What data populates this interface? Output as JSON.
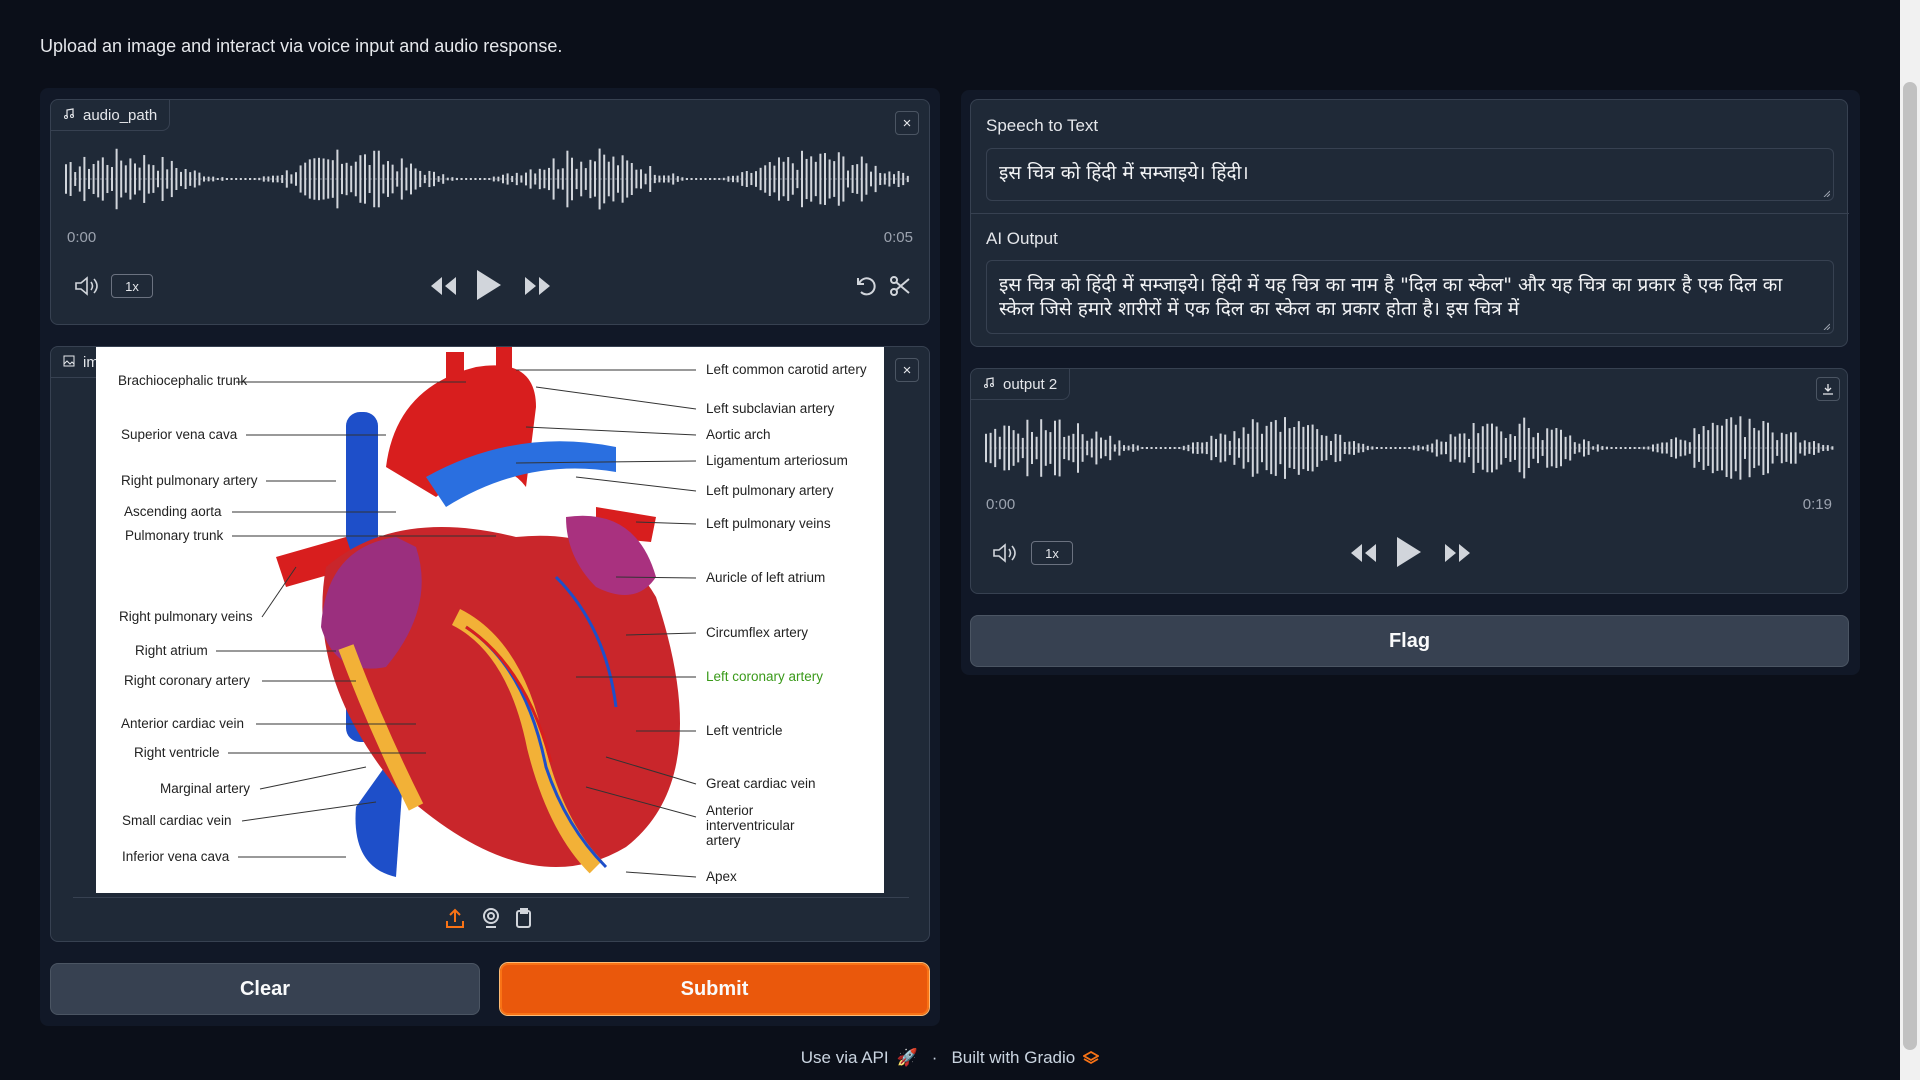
{
  "description": "Upload an image and interact via voice input and audio response.",
  "audio_input": {
    "label": "audio_path",
    "time_start": "0:00",
    "time_end": "0:05",
    "playback_rate": "1x"
  },
  "image_input": {
    "label": "image_path",
    "diagram_labels": {
      "left": [
        "Brachiocephalic trunk",
        "Superior vena cava",
        "Right pulmonary artery",
        "Ascending aorta",
        "Pulmonary trunk",
        "Right pulmonary veins",
        "Right atrium",
        "Right coronary artery",
        "Anterior cardiac vein",
        "Right ventricle",
        "Marginal artery",
        "Small cardiac vein",
        "Inferior vena cava"
      ],
      "right": [
        "Left common carotid artery",
        "Left subclavian artery",
        "Aortic arch",
        "Ligamentum arteriosum",
        "Left pulmonary artery",
        "Left pulmonary veins",
        "Auricle of left atrium",
        "Circumflex artery",
        "Left coronary artery",
        "Left ventricle",
        "Great cardiac vein",
        "Anterior interventricular artery",
        "Apex"
      ]
    }
  },
  "buttons": {
    "clear": "Clear",
    "submit": "Submit",
    "flag": "Flag"
  },
  "speech_to_text": {
    "label": "Speech to Text",
    "value": "इस चित्र को हिंदी में सम्जाइये। हिंदी।"
  },
  "ai_output": {
    "label": "AI Output",
    "value": "इस चित्र को हिंदी में सम्जाइये। हिंदी में यह चित्र का नाम है \"दिल का स्केल\" और यह चित्र का प्रकार है एक दिल का स्केल जिसे हमारे शारीरों में एक दिल का स्केल का प्रकार होता है। इस चित्र में"
  },
  "audio_output": {
    "label": "output 2",
    "time_start": "0:00",
    "time_end": "0:19",
    "playback_rate": "1x"
  },
  "footer": {
    "api_link": "Use via API",
    "separator": "·",
    "built_with": "Built with Gradio"
  },
  "colors": {
    "background": "#0b0f19",
    "panel": "#111827",
    "block": "#1f2937",
    "accent": "#ea580c"
  }
}
